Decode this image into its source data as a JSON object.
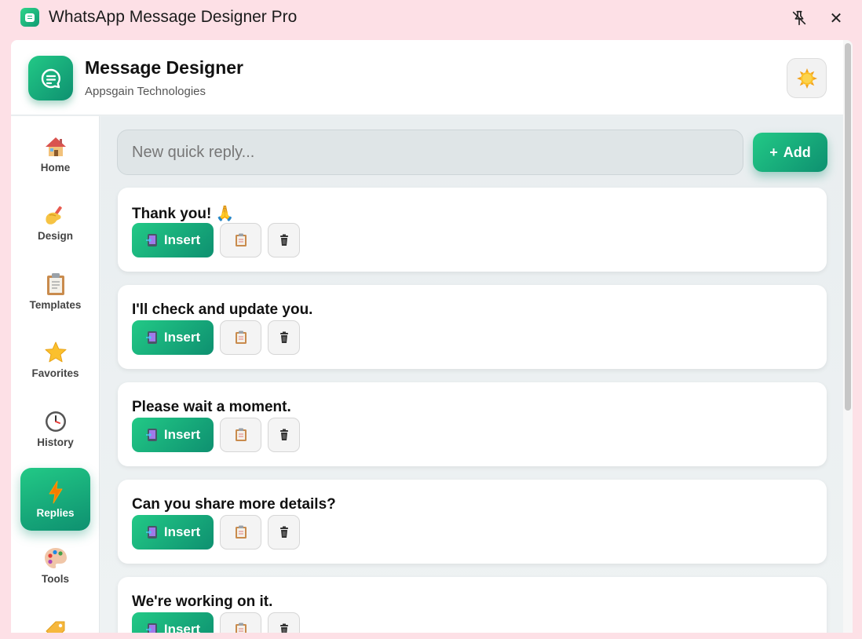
{
  "titlebar": {
    "title": "WhatsApp Message Designer Pro",
    "icons": {
      "app": "chat-bubble-icon",
      "pin": "pin-off-icon",
      "close": "close-icon"
    },
    "close_glyph": "✕"
  },
  "header": {
    "title": "Message Designer",
    "subtitle": "Appsgain Technologies",
    "logo_icon": "chat-bubble-icon",
    "theme_icon": "sun-icon"
  },
  "sidebar": {
    "items": [
      {
        "label": "Home",
        "icon": "house-icon",
        "active": false
      },
      {
        "label": "Design",
        "icon": "writing-hand-icon",
        "active": false
      },
      {
        "label": "Templates",
        "icon": "clipboard-icon",
        "active": false
      },
      {
        "label": "Favorites",
        "icon": "star-icon",
        "active": false
      },
      {
        "label": "History",
        "icon": "clock-icon",
        "active": false
      },
      {
        "label": "Replies",
        "icon": "lightning-icon",
        "active": true
      },
      {
        "label": "Tools",
        "icon": "palette-icon",
        "active": false
      },
      {
        "label": "",
        "icon": "tag-icon",
        "active": false
      }
    ]
  },
  "quick_reply": {
    "placeholder": "New quick reply...",
    "add_label": "Add",
    "add_glyph": "+"
  },
  "replies": [
    {
      "text": "Thank you! 🙏",
      "insert_label": "Insert"
    },
    {
      "text": "I'll check and update you.",
      "insert_label": "Insert"
    },
    {
      "text": "Please wait a moment.",
      "insert_label": "Insert"
    },
    {
      "text": "Can you share more details?",
      "insert_label": "Insert"
    },
    {
      "text": "We're working on it.",
      "insert_label": "Insert"
    }
  ],
  "colors": {
    "accent_start": "#22c986",
    "accent_end": "#0e9070",
    "frame_background": "#fde0e6"
  }
}
